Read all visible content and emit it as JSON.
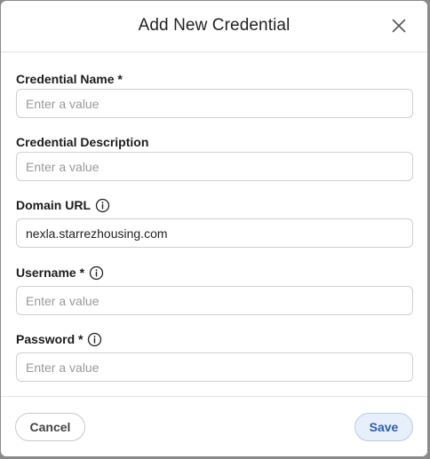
{
  "dialog": {
    "title": "Add New Credential"
  },
  "fields": {
    "credential_name": {
      "label": "Credential Name *",
      "placeholder": "Enter a value",
      "value": ""
    },
    "credential_description": {
      "label": "Credential Description",
      "placeholder": "Enter a value",
      "value": ""
    },
    "domain_url": {
      "label": "Domain URL",
      "placeholder": "Enter a value",
      "value": "nexla.starrezhousing.com",
      "info_icon": "info-circle-icon"
    },
    "username": {
      "label": "Username *",
      "placeholder": "Enter a value",
      "value": "",
      "info_icon": "info-circle-icon"
    },
    "password": {
      "label": "Password *",
      "placeholder": "Enter a value",
      "value": "",
      "info_icon": "info-circle-icon"
    }
  },
  "footer": {
    "cancel_label": "Cancel",
    "save_label": "Save"
  },
  "colors": {
    "save_bg": "#e7effa",
    "save_text": "#2a5db0",
    "border": "#cfcfcf"
  }
}
